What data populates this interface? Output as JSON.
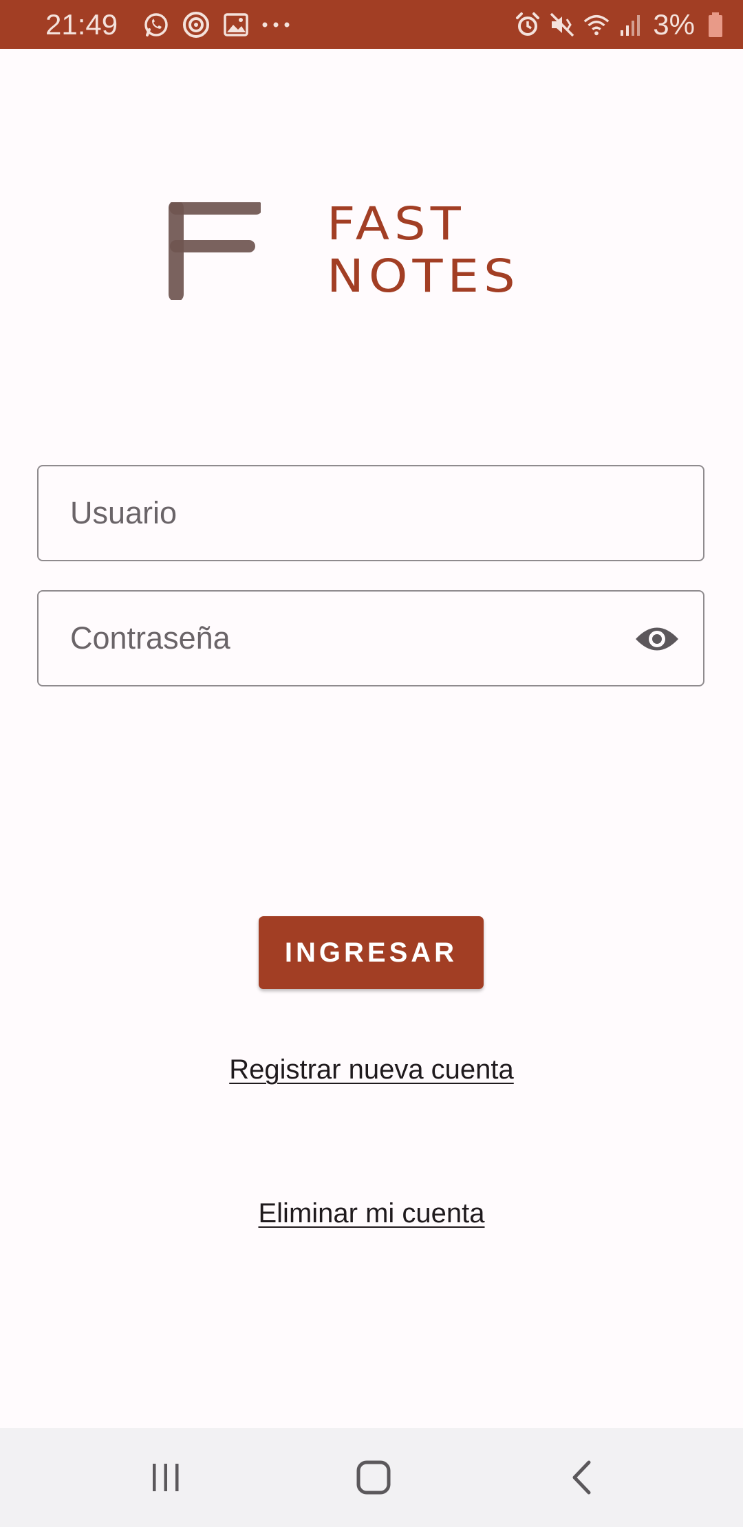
{
  "status_bar": {
    "time": "21:49",
    "battery": "3%",
    "left_icons": [
      "whatsapp-icon",
      "circle-target-icon",
      "image-icon",
      "more-dots-icon"
    ],
    "right_icons": [
      "alarm-icon",
      "vibrate-mute-icon",
      "wifi-icon",
      "signal-icon",
      "battery-icon"
    ],
    "color": "#a23e24"
  },
  "logo": {
    "letter": "F",
    "line1": "FAST",
    "line2": "NOTES",
    "letter_color": "#6f5550",
    "text_color": "#a23e24"
  },
  "form": {
    "username_placeholder": "Usuario",
    "password_placeholder": "Contraseña",
    "username_value": "",
    "password_value": ""
  },
  "actions": {
    "login_label": "INGRESAR",
    "register_link": "Registrar nueva cuenta",
    "delete_link": "Eliminar mi cuenta"
  },
  "colors": {
    "accent": "#a23e24",
    "background": "#fffbfd",
    "nav_bar": "#f2f1f3"
  },
  "nav_bar": {
    "buttons": [
      "recents-icon",
      "home-icon",
      "back-icon"
    ]
  }
}
